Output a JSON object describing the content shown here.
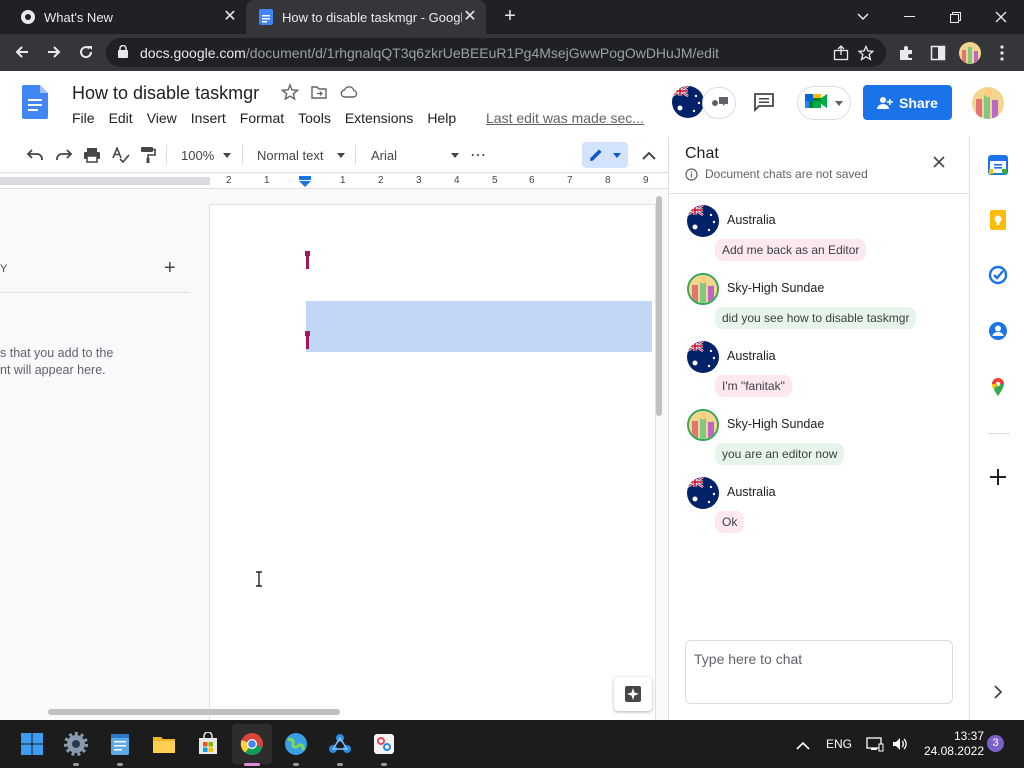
{
  "browser": {
    "tabs": [
      {
        "title": "What's New",
        "active": false
      },
      {
        "title": "How to disable taskmgr - Google",
        "active": true
      }
    ],
    "url_host": "docs.google.com",
    "url_path": "/document/d/1rhgnalqQT3q6zkrUeBEEuR1Pg4MsejGwwPogOwDHuJM/edit"
  },
  "docs": {
    "title": "How to disable taskmgr",
    "menu": [
      "File",
      "Edit",
      "View",
      "Insert",
      "Format",
      "Tools",
      "Extensions",
      "Help"
    ],
    "last_edit": "Last edit was made sec...",
    "share_label": "Share"
  },
  "toolbar": {
    "zoom": "100%",
    "style": "Normal text",
    "font": "Arial",
    "more": "⋯"
  },
  "ruler": {
    "labels": [
      "2",
      "1",
      "1",
      "2",
      "3",
      "4",
      "5",
      "6",
      "7",
      "8",
      "9"
    ]
  },
  "outline": {
    "heading_fragment": "Y",
    "hint_line1": "s that you add to the",
    "hint_line2": "nt will appear here."
  },
  "chat": {
    "title": "Chat",
    "note": "Document chats are not saved",
    "input_placeholder": "Type here to chat",
    "messages": [
      {
        "sender": "Australia",
        "text": "Add me back as an Editor"
      },
      {
        "sender": "Sky-High Sundae",
        "text": "did you see how to disable taskmgr"
      },
      {
        "sender": "Australia",
        "text": "I'm \"fanitak\""
      },
      {
        "sender": "Sky-High Sundae",
        "text": "you are an editor now"
      },
      {
        "sender": "Australia",
        "text": "Ok"
      }
    ]
  },
  "taskbar": {
    "language": "ENG",
    "time": "13:37",
    "date": "24.08.2022",
    "notifications": "3"
  },
  "colors": {
    "accent": "#1a73e8",
    "selection": "#c2d7f5",
    "cursor_mark": "#a0185c"
  }
}
